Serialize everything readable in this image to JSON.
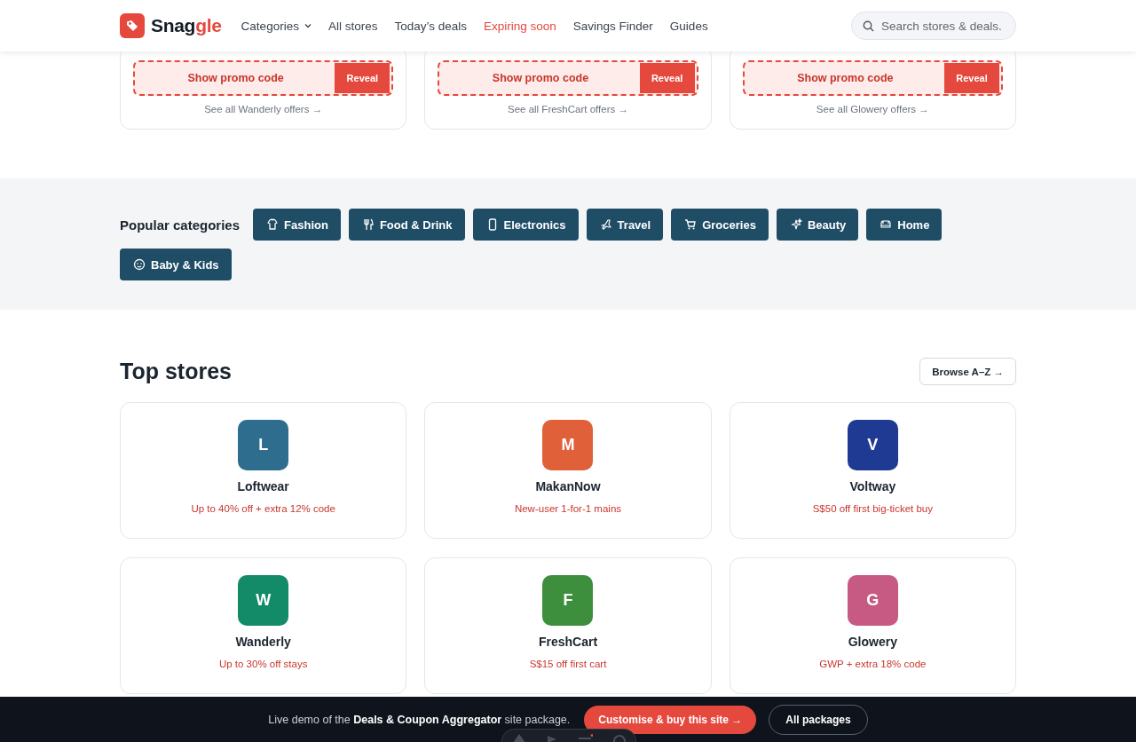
{
  "header": {
    "brand": {
      "main": "Snag",
      "accent": "gle"
    },
    "nav": [
      {
        "label": "Categories",
        "kind": "dropdown",
        "highlighted": false
      },
      {
        "label": "All stores",
        "kind": "link",
        "highlighted": false
      },
      {
        "label": "Today’s deals",
        "kind": "link",
        "highlighted": false
      },
      {
        "label": "Expiring soon",
        "kind": "link",
        "highlighted": true
      },
      {
        "label": "Savings Finder",
        "kind": "link",
        "highlighted": false
      },
      {
        "label": "Guides",
        "kind": "link",
        "highlighted": false
      }
    ],
    "search": {
      "placeholder": "Search stores & deals."
    }
  },
  "offer_cards": [
    {
      "promo_label": "Show promo code",
      "button": "Reveal",
      "link": "See all Wanderly offers →"
    },
    {
      "promo_label": "Show promo code",
      "button": "Reveal",
      "link": "See all FreshCart offers →"
    },
    {
      "promo_label": "Show promo code",
      "button": "Reveal",
      "link": "See all Glowery offers →"
    }
  ],
  "categories": {
    "title": "Popular categories",
    "items": [
      {
        "label": "Fashion"
      },
      {
        "label": "Food & Drink"
      },
      {
        "label": "Electronics"
      },
      {
        "label": "Travel"
      },
      {
        "label": "Groceries"
      },
      {
        "label": "Beauty"
      },
      {
        "label": "Home"
      },
      {
        "label": "Baby & Kids"
      }
    ]
  },
  "top_stores": {
    "title": "Top stores",
    "browse_button": "Browse A–Z →",
    "stores": [
      {
        "initial": "L",
        "name": "Loftwear",
        "offer": "Up to 40% off + extra 12% code",
        "color": "#2e6d8e"
      },
      {
        "initial": "M",
        "name": "MakanNow",
        "offer": "New-user 1-for-1 mains",
        "color": "#e0603a"
      },
      {
        "initial": "V",
        "name": "Voltway",
        "offer": "S$50 off first big-ticket buy",
        "color": "#1f3a93"
      },
      {
        "initial": "W",
        "name": "Wanderly",
        "offer": "Up to 30% off stays",
        "color": "#138a68"
      },
      {
        "initial": "F",
        "name": "FreshCart",
        "offer": "S$15 off first cart",
        "color": "#3d8f3e"
      },
      {
        "initial": "G",
        "name": "Glowery",
        "offer": "GWP + extra 18% code",
        "color": "#c75a82"
      }
    ]
  },
  "demo_bar": {
    "text": "Live demo of the **Deals & Coupon Aggregator** site package.",
    "primary_button": "Customise & buy this site →",
    "secondary_button": "All packages"
  }
}
